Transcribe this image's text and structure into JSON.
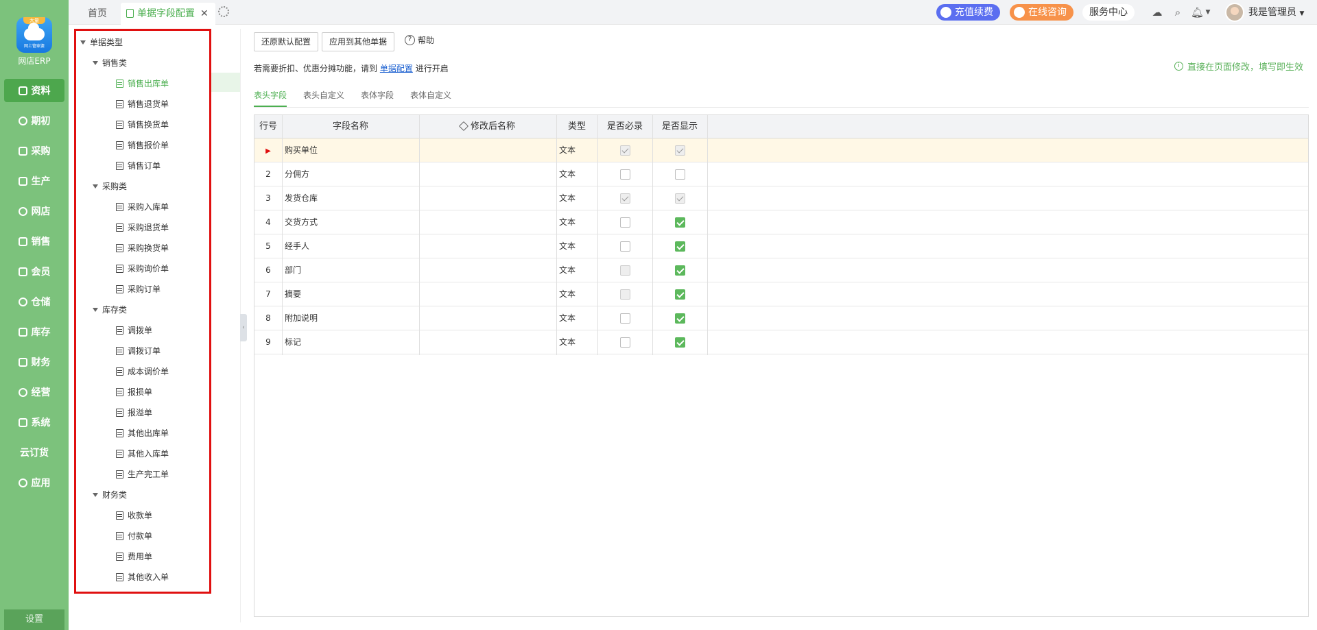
{
  "app": {
    "name": "网店ERP",
    "logo_badge": "大量",
    "logo_sub": "网上管家婆"
  },
  "nav": {
    "items": [
      {
        "label": "资料",
        "icon": "data-icon",
        "active": true
      },
      {
        "label": "期初",
        "icon": "clock-icon"
      },
      {
        "label": "采购",
        "icon": "purchase-icon"
      },
      {
        "label": "生产",
        "icon": "production-icon"
      },
      {
        "label": "网店",
        "icon": "shop-icon"
      },
      {
        "label": "销售",
        "icon": "sales-icon"
      },
      {
        "label": "会员",
        "icon": "member-icon"
      },
      {
        "label": "仓储",
        "icon": "warehouse-icon"
      },
      {
        "label": "库存",
        "icon": "inventory-icon"
      },
      {
        "label": "财务",
        "icon": "finance-icon"
      },
      {
        "label": "经营",
        "icon": "business-icon"
      },
      {
        "label": "系统",
        "icon": "system-icon"
      },
      {
        "label": "云订货",
        "icon": ""
      },
      {
        "label": "应用",
        "icon": "apps-icon"
      }
    ],
    "settings": "设置"
  },
  "topbar": {
    "tabs": [
      {
        "label": "首页"
      },
      {
        "label": "单据字段配置",
        "active": true
      }
    ],
    "recharge": "充值续费",
    "consult": "在线咨询",
    "service": "服务中心",
    "user": "我是管理员"
  },
  "tree": {
    "root": "单据类型",
    "categories": [
      {
        "label": "销售类",
        "items": [
          "销售出库单",
          "销售退货单",
          "销售换货单",
          "销售报价单",
          "销售订单"
        ]
      },
      {
        "label": "采购类",
        "items": [
          "采购入库单",
          "采购退货单",
          "采购换货单",
          "采购询价单",
          "采购订单"
        ]
      },
      {
        "label": "库存类",
        "items": [
          "调拨单",
          "调拨订单",
          "成本调价单",
          "报损单",
          "报溢单",
          "其他出库单",
          "其他入库单",
          "生产完工单"
        ]
      },
      {
        "label": "财务类",
        "items": [
          "收款单",
          "付款单",
          "费用单",
          "其他收入单"
        ]
      }
    ],
    "selected": "销售出库单"
  },
  "toolbar": {
    "restore": "还原默认配置",
    "apply": "应用到其他单据",
    "help": "帮助"
  },
  "hint": {
    "prefix": "若需要折扣、优惠分摊功能，请到",
    "link": "单据配置",
    "suffix": "进行开启"
  },
  "tip": "直接在页面修改，填写即生效",
  "subtabs": [
    {
      "label": "表头字段",
      "active": true
    },
    {
      "label": "表头自定义"
    },
    {
      "label": "表体字段"
    },
    {
      "label": "表体自定义"
    }
  ],
  "grid": {
    "columns": [
      "行号",
      "字段名称",
      "修改后名称",
      "类型",
      "是否必录",
      "是否显示"
    ],
    "rows": [
      {
        "no": "",
        "name": "购买单位",
        "alias": "",
        "type": "文本",
        "required": "disabled-checked",
        "show": "disabled-checked",
        "current": true
      },
      {
        "no": "2",
        "name": "分佣方",
        "alias": "",
        "type": "文本",
        "required": "unchecked",
        "show": "unchecked"
      },
      {
        "no": "3",
        "name": "发货仓库",
        "alias": "",
        "type": "文本",
        "required": "disabled-checked",
        "show": "disabled-checked"
      },
      {
        "no": "4",
        "name": "交货方式",
        "alias": "",
        "type": "文本",
        "required": "unchecked",
        "show": "checked"
      },
      {
        "no": "5",
        "name": "经手人",
        "alias": "",
        "type": "文本",
        "required": "unchecked",
        "show": "checked"
      },
      {
        "no": "6",
        "name": "部门",
        "alias": "",
        "type": "文本",
        "required": "disabled",
        "show": "checked"
      },
      {
        "no": "7",
        "name": "摘要",
        "alias": "",
        "type": "文本",
        "required": "disabled",
        "show": "checked"
      },
      {
        "no": "8",
        "name": "附加说明",
        "alias": "",
        "type": "文本",
        "required": "unchecked",
        "show": "checked"
      },
      {
        "no": "9",
        "name": "标记",
        "alias": "",
        "type": "文本",
        "required": "unchecked",
        "show": "checked"
      }
    ]
  },
  "colors": {
    "nav_bg": "#7cc27c",
    "accent": "#4caf50",
    "highlight_border": "#e01010"
  }
}
